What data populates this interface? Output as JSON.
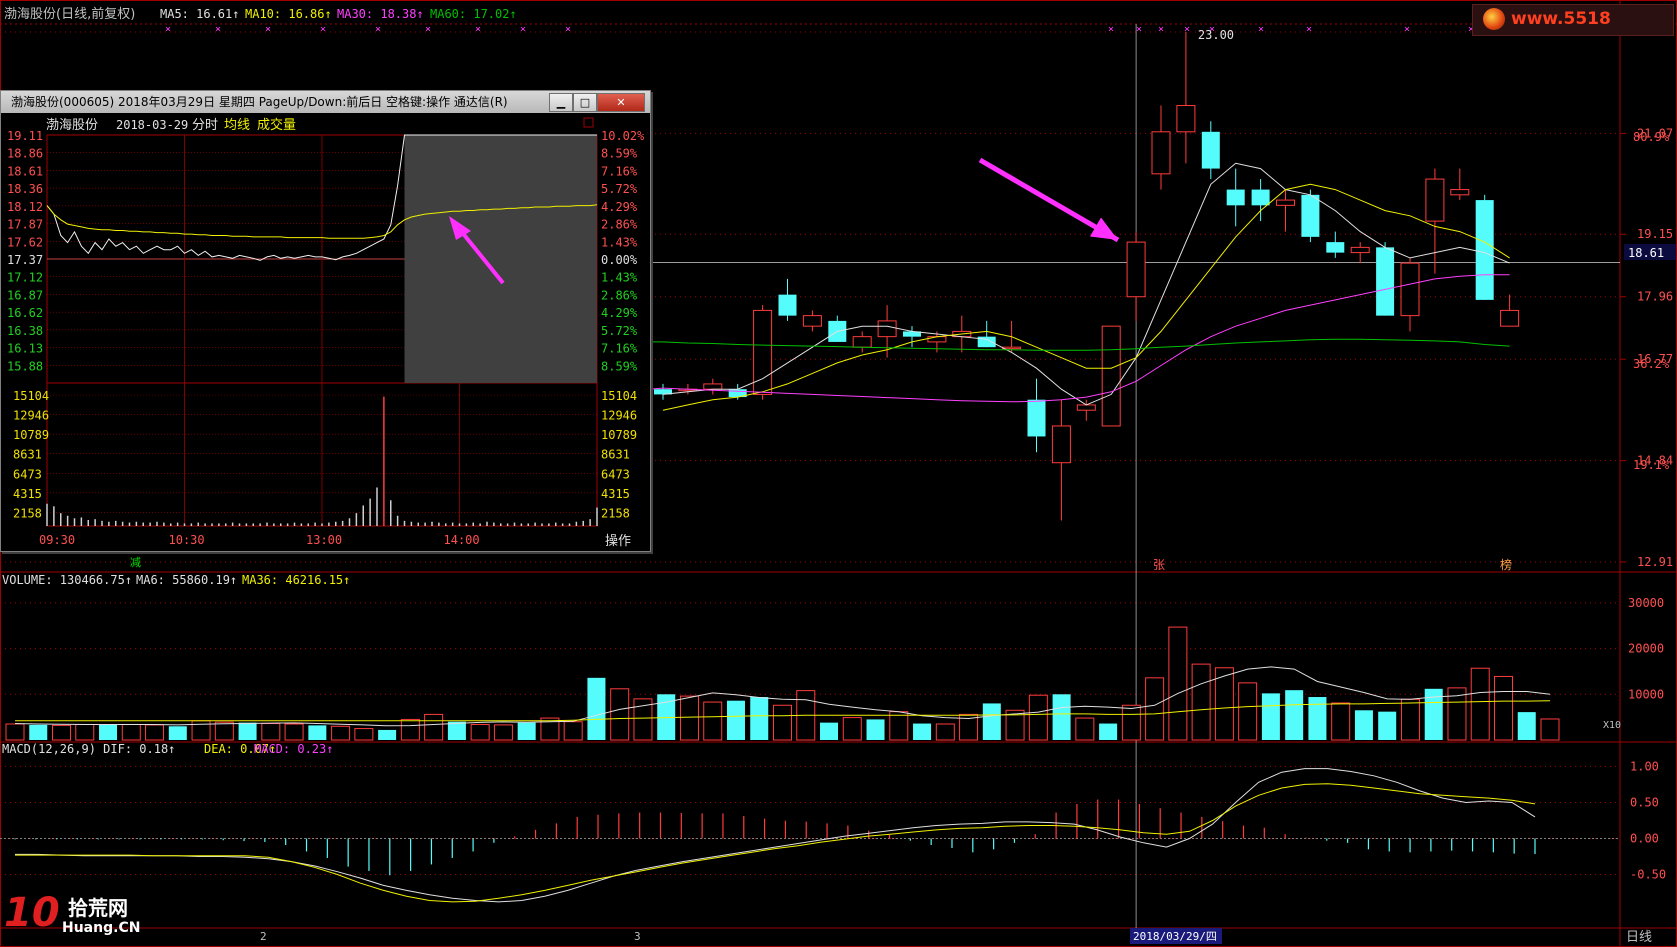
{
  "colors": {
    "up": "#ff3c3c",
    "down": "#54fcfc",
    "white": "#e0e0e0",
    "yellow": "#f0f000",
    "magenta": "#ff40ff",
    "green": "#00c000",
    "grid_red": "#a00000",
    "label_red": "#ff5050"
  },
  "main": {
    "title": "渤海股份(日线,前复权)",
    "indicators": [
      {
        "label": "MA5:",
        "value": "16.61",
        "color": "#e0e0e0"
      },
      {
        "label": "MA10:",
        "value": "16.86",
        "color": "#f0f000"
      },
      {
        "label": "MA30:",
        "value": "18.38",
        "color": "#ff40ff"
      },
      {
        "label": "MA60:",
        "value": "17.02",
        "color": "#00c000"
      }
    ],
    "price_axis": [
      "23.00",
      "21.07",
      "19.15",
      "17.96",
      "16.77",
      "14.84",
      "12.91"
    ],
    "pct_axis": [
      "80.9%",
      "36.2%",
      "19.1%"
    ],
    "current_price": "18.61",
    "high_label": "23.00",
    "markers": {
      "zhang": "张",
      "bang": "榜",
      "jian": "减"
    },
    "period_label": "日线",
    "date_labels": [
      "2",
      "3"
    ],
    "crosshair_date": "2018/03/29/四"
  },
  "volume": {
    "header": [
      {
        "text": "VOLUME: 130466.75",
        "color": "#e0e0e0"
      },
      {
        "text": "MA6: 55860.19",
        "color": "#e0e0e0"
      },
      {
        "text": "MA36: 46216.15",
        "color": "#f0f000"
      }
    ],
    "axis": [
      "30000",
      "20000",
      "10000"
    ],
    "unit": "X10"
  },
  "macd": {
    "header": [
      {
        "text": "MACD(12,26,9) DIF: 0.18",
        "color": "#e0e0e0"
      },
      {
        "text": "DEA: 0.07",
        "color": "#f0f000"
      },
      {
        "text": "MACD: 0.23",
        "color": "#ff40ff"
      }
    ],
    "axis": [
      "1.00",
      "0.50",
      "0.00",
      "-0.50"
    ]
  },
  "popup": {
    "title": "渤海股份(000605) 2018年03月29日 星期四 PageUp/Down:前后日 空格键:操作 通达信(R)",
    "stock_name": "渤海股份",
    "date": "2018-03-29",
    "mode": "分时",
    "avg_label": "均线",
    "vol_label": "成交量",
    "price_ticks": [
      "19.11",
      "18.86",
      "18.61",
      "18.36",
      "18.12",
      "17.87",
      "17.62",
      "17.37",
      "17.12",
      "16.87",
      "16.62",
      "16.38",
      "16.13",
      "15.88"
    ],
    "pct_ticks": [
      "10.02%",
      "8.59%",
      "7.16%",
      "5.72%",
      "4.29%",
      "2.86%",
      "1.43%",
      "0.00%",
      "1.43%",
      "2.86%",
      "4.29%",
      "5.72%",
      "7.16%",
      "8.59%"
    ],
    "vol_ticks": [
      "15104",
      "12946",
      "10789",
      "8631",
      "6473",
      "4315",
      "2158"
    ],
    "time_ticks": [
      "09:30",
      "10:30",
      "13:00",
      "14:00"
    ],
    "action_label": "操作"
  },
  "watermarks": {
    "site_top": "www.5518",
    "logo_cn": "拾荒网",
    "logo_en": "Huang.CN",
    "logo_num": "10"
  },
  "chart_data": [
    {
      "type": "candlestick",
      "title": "渤海股份(日线,前复权)",
      "ylim": [
        12.91,
        23.0
      ],
      "series_ohlc": [
        {
          "o": 16.2,
          "h": 16.3,
          "l": 16.0,
          "c": 16.1
        },
        {
          "o": 16.2,
          "h": 16.3,
          "l": 16.1,
          "c": 16.2
        },
        {
          "o": 16.2,
          "h": 16.4,
          "l": 16.1,
          "c": 16.3
        },
        {
          "o": 16.2,
          "h": 16.3,
          "l": 16.0,
          "c": 16.05
        },
        {
          "o": 16.1,
          "h": 17.8,
          "l": 16.0,
          "c": 17.7
        },
        {
          "o": 18.0,
          "h": 18.3,
          "l": 17.5,
          "c": 17.6
        },
        {
          "o": 17.4,
          "h": 17.7,
          "l": 17.3,
          "c": 17.6
        },
        {
          "o": 17.5,
          "h": 17.6,
          "l": 17.1,
          "c": 17.1
        },
        {
          "o": 17.0,
          "h": 17.3,
          "l": 16.9,
          "c": 17.2
        },
        {
          "o": 17.2,
          "h": 17.8,
          "l": 16.8,
          "c": 17.5
        },
        {
          "o": 17.3,
          "h": 17.4,
          "l": 17.0,
          "c": 17.2
        },
        {
          "o": 17.1,
          "h": 17.3,
          "l": 16.9,
          "c": 17.2
        },
        {
          "o": 17.2,
          "h": 17.6,
          "l": 16.9,
          "c": 17.3
        },
        {
          "o": 17.2,
          "h": 17.5,
          "l": 17.0,
          "c": 17.0
        },
        {
          "o": 17.0,
          "h": 17.5,
          "l": 16.9,
          "c": 17.0
        },
        {
          "o": 16.0,
          "h": 16.4,
          "l": 15.0,
          "c": 15.3
        },
        {
          "o": 14.8,
          "h": 16.0,
          "l": 13.7,
          "c": 15.5
        },
        {
          "o": 15.8,
          "h": 16.0,
          "l": 15.6,
          "c": 15.9
        },
        {
          "o": 15.5,
          "h": 17.4,
          "l": 15.5,
          "c": 17.4
        },
        {
          "o": 17.96,
          "h": 19.2,
          "l": 17.5,
          "c": 19.0
        },
        {
          "o": 20.3,
          "h": 21.6,
          "l": 20.0,
          "c": 21.1
        },
        {
          "o": 21.1,
          "h": 23.0,
          "l": 20.5,
          "c": 21.6
        },
        {
          "o": 21.1,
          "h": 21.3,
          "l": 20.2,
          "c": 20.4
        },
        {
          "o": 20.0,
          "h": 20.4,
          "l": 19.3,
          "c": 19.7
        },
        {
          "o": 20.0,
          "h": 20.2,
          "l": 19.4,
          "c": 19.7
        },
        {
          "o": 19.7,
          "h": 20.0,
          "l": 19.2,
          "c": 19.8
        },
        {
          "o": 19.9,
          "h": 20.0,
          "l": 19.0,
          "c": 19.1
        },
        {
          "o": 19.0,
          "h": 19.2,
          "l": 18.7,
          "c": 18.8
        },
        {
          "o": 18.8,
          "h": 19.0,
          "l": 18.6,
          "c": 18.9
        },
        {
          "o": 18.9,
          "h": 19.0,
          "l": 17.6,
          "c": 17.6
        },
        {
          "o": 17.6,
          "h": 18.7,
          "l": 17.3,
          "c": 18.6
        },
        {
          "o": 19.4,
          "h": 20.4,
          "l": 18.4,
          "c": 20.2
        },
        {
          "o": 19.9,
          "h": 20.4,
          "l": 19.8,
          "c": 20.0
        },
        {
          "o": 19.8,
          "h": 19.9,
          "l": 17.9,
          "c": 17.9
        },
        {
          "o": 17.4,
          "h": 18.0,
          "l": 17.4,
          "c": 17.7
        }
      ],
      "ma5": [
        16.1,
        16.15,
        16.2,
        16.2,
        16.4,
        16.7,
        17.0,
        17.3,
        17.4,
        17.4,
        17.3,
        17.25,
        17.2,
        17.15,
        16.9,
        16.6,
        16.2,
        15.9,
        16.1,
        16.8,
        17.9,
        19.0,
        20.1,
        20.5,
        20.4,
        20.0,
        19.9,
        19.6,
        19.2,
        18.9,
        18.7,
        18.8,
        18.9,
        18.8,
        18.6
      ],
      "ma10": [
        15.8,
        15.9,
        16.0,
        16.05,
        16.15,
        16.3,
        16.5,
        16.7,
        16.85,
        16.95,
        17.1,
        17.2,
        17.25,
        17.3,
        17.2,
        17.0,
        16.8,
        16.6,
        16.6,
        16.8,
        17.3,
        17.9,
        18.5,
        19.1,
        19.6,
        20.0,
        20.1,
        20.0,
        19.8,
        19.6,
        19.5,
        19.3,
        19.2,
        19.0,
        18.7
      ],
      "ma30": [
        16.22,
        16.2,
        16.18,
        16.16,
        16.14,
        16.12,
        16.1,
        16.08,
        16.06,
        16.04,
        16.02,
        16.0,
        15.98,
        15.97,
        15.96,
        15.97,
        16.0,
        16.05,
        16.15,
        16.35,
        16.65,
        16.95,
        17.2,
        17.4,
        17.55,
        17.7,
        17.8,
        17.9,
        18.0,
        18.1,
        18.2,
        18.3,
        18.35,
        18.38,
        18.38
      ],
      "ma60": [
        17.1,
        17.08,
        17.07,
        17.05,
        17.04,
        17.03,
        17.02,
        17.01,
        17.0,
        16.99,
        16.98,
        16.97,
        16.96,
        16.95,
        16.95,
        16.94,
        16.94,
        16.94,
        16.95,
        16.97,
        17.0,
        17.02,
        17.05,
        17.08,
        17.1,
        17.12,
        17.14,
        17.15,
        17.15,
        17.14,
        17.13,
        17.12,
        17.1,
        17.05,
        17.02
      ]
    },
    {
      "type": "bar",
      "title": "VOLUME",
      "ylim": [
        0,
        35000
      ],
      "values": [
        3500,
        3300,
        3200,
        3400,
        3300,
        3400,
        3300,
        3000,
        4200,
        3900,
        3800,
        3600,
        3500,
        3200,
        3000,
        2500,
        2200,
        4500,
        5600,
        4000,
        3400,
        3300,
        3800,
        4800,
        4000,
        13600,
        11200,
        9000,
        10000,
        9600,
        8300,
        8600,
        9400,
        7600,
        10800,
        3800,
        4900,
        4500,
        6200,
        3600,
        3500,
        5600,
        8000,
        6500,
        9800,
        10000,
        4800,
        3600,
        7600,
        13600,
        24700,
        16600,
        15800,
        12500,
        10200,
        10900,
        9400,
        8100,
        6500,
        6200,
        8900,
        11200,
        11400,
        15700,
        13900,
        6100,
        4600
      ],
      "ma6": [
        3600,
        3500,
        3450,
        3400,
        3380,
        3400,
        3380,
        3300,
        3450,
        3550,
        3600,
        3700,
        3750,
        3620,
        3460,
        3300,
        3100,
        3150,
        3380,
        3640,
        3860,
        3960,
        3900,
        4000,
        4100,
        5400,
        6700,
        7500,
        8300,
        9300,
        10300,
        9900,
        9300,
        8900,
        8800,
        7800,
        7200,
        6600,
        6200,
        5300,
        4900,
        4700,
        5300,
        5700,
        6100,
        7100,
        7400,
        7200,
        6900,
        7600,
        10200,
        12300,
        14000,
        15500,
        16000,
        15500,
        12800,
        11600,
        10400,
        9000,
        8900,
        9400,
        9700,
        10400,
        10600,
        10600,
        10000
      ],
      "ma36": [
        4200,
        4200,
        4200,
        4200,
        4200,
        4200,
        4200,
        4200,
        4200,
        4200,
        4200,
        4200,
        4200,
        4200,
        4200,
        4200,
        4200,
        4200,
        4200,
        4200,
        4200,
        4200,
        4200,
        4200,
        4300,
        4500,
        4700,
        4800,
        4900,
        5000,
        5100,
        5200,
        5300,
        5300,
        5400,
        5400,
        5400,
        5400,
        5400,
        5400,
        5400,
        5400,
        5500,
        5500,
        5600,
        5700,
        5700,
        5600,
        5600,
        5700,
        6200,
        6600,
        7000,
        7300,
        7500,
        7700,
        7800,
        7900,
        7900,
        8000,
        8100,
        8200,
        8300,
        8400,
        8500,
        8500,
        8600
      ]
    },
    {
      "type": "bar",
      "title": "MACD(12,26,9)",
      "ylim": [
        -1.2,
        1.2
      ],
      "macd": [
        -0.02,
        -0.02,
        -0.02,
        -0.02,
        -0.02,
        -0.02,
        -0.02,
        -0.02,
        -0.02,
        -0.02,
        -0.04,
        -0.06,
        -0.08,
        -0.15,
        -0.3,
        -0.45,
        -0.65,
        -0.75,
        -0.85,
        -0.75,
        -0.6,
        -0.45,
        -0.3,
        -0.1,
        0.05,
        0.2,
        0.35,
        0.5,
        0.55,
        0.58,
        0.6,
        0.6,
        0.59,
        0.58,
        0.58,
        0.52,
        0.46,
        0.41,
        0.39,
        0.35,
        0.3,
        0.18,
        0.08,
        -0.05,
        -0.15,
        -0.22,
        -0.32,
        -0.25,
        -0.1,
        0.1,
        0.6,
        0.8,
        0.9,
        0.9,
        0.8,
        0.7,
        0.6,
        0.5,
        0.4,
        0.3,
        0.25,
        0.1,
        0.02,
        -0.05,
        -0.1,
        -0.25,
        -0.3,
        -0.32,
        -0.3,
        -0.28,
        -0.3,
        -0.32,
        -0.35,
        -0.36
      ],
      "dif": [
        -0.22,
        -0.22,
        -0.23,
        -0.24,
        -0.24,
        -0.24,
        -0.24,
        -0.24,
        -0.25,
        -0.25,
        -0.26,
        -0.28,
        -0.32,
        -0.38,
        -0.46,
        -0.55,
        -0.65,
        -0.72,
        -0.78,
        -0.83,
        -0.86,
        -0.88,
        -0.86,
        -0.8,
        -0.72,
        -0.62,
        -0.52,
        -0.44,
        -0.38,
        -0.32,
        -0.27,
        -0.22,
        -0.17,
        -0.12,
        -0.07,
        -0.02,
        0.03,
        0.07,
        0.11,
        0.15,
        0.18,
        0.2,
        0.21,
        0.23,
        0.23,
        0.22,
        0.2,
        0.12,
        0.02,
        -0.06,
        -0.12,
        0.0,
        0.2,
        0.5,
        0.78,
        0.92,
        0.97,
        0.97,
        0.93,
        0.87,
        0.78,
        0.66,
        0.56,
        0.5,
        0.52,
        0.5,
        0.3
      ],
      "dea": [
        -0.23,
        -0.23,
        -0.23,
        -0.23,
        -0.23,
        -0.23,
        -0.24,
        -0.24,
        -0.24,
        -0.24,
        -0.24,
        -0.26,
        -0.32,
        -0.4,
        -0.5,
        -0.62,
        -0.72,
        -0.8,
        -0.86,
        -0.88,
        -0.87,
        -0.83,
        -0.78,
        -0.72,
        -0.65,
        -0.58,
        -0.52,
        -0.46,
        -0.4,
        -0.34,
        -0.29,
        -0.24,
        -0.19,
        -0.14,
        -0.1,
        -0.05,
        -0.01,
        0.03,
        0.06,
        0.09,
        0.12,
        0.14,
        0.15,
        0.17,
        0.18,
        0.18,
        0.17,
        0.15,
        0.12,
        0.08,
        0.06,
        0.1,
        0.25,
        0.45,
        0.6,
        0.7,
        0.75,
        0.76,
        0.74,
        0.7,
        0.66,
        0.62,
        0.6,
        0.58,
        0.56,
        0.53,
        0.48
      ]
    },
    {
      "type": "line",
      "title": "渤海股份 2018-03-29 分时",
      "ylim": [
        15.63,
        19.11
      ],
      "price": [
        18.12,
        18.0,
        17.7,
        17.6,
        17.75,
        17.55,
        17.45,
        17.6,
        17.5,
        17.65,
        17.55,
        17.6,
        17.5,
        17.55,
        17.45,
        17.5,
        17.55,
        17.5,
        17.5,
        17.55,
        17.45,
        17.5,
        17.42,
        17.48,
        17.4,
        17.42,
        17.4,
        17.38,
        17.42,
        17.4,
        17.38,
        17.35,
        17.4,
        17.42,
        17.38,
        17.4,
        17.38,
        17.4,
        17.42,
        17.4,
        17.4,
        17.38,
        17.36,
        17.4,
        17.42,
        17.45,
        17.5,
        17.55,
        17.6,
        17.65,
        17.85,
        18.4,
        19.11,
        19.11,
        19.11,
        19.11,
        19.11,
        19.11,
        19.11,
        19.11,
        19.11,
        19.11,
        19.11,
        19.11,
        19.11,
        19.11,
        19.11,
        19.11,
        19.11,
        19.11,
        19.11,
        19.11,
        19.11,
        19.11,
        19.11,
        19.11,
        19.11,
        19.11,
        19.11,
        19.11,
        19.11
      ],
      "avg": [
        18.12,
        18.0,
        17.92,
        17.86,
        17.84,
        17.82,
        17.8,
        17.79,
        17.78,
        17.78,
        17.77,
        17.77,
        17.76,
        17.76,
        17.75,
        17.75,
        17.74,
        17.74,
        17.73,
        17.73,
        17.72,
        17.72,
        17.71,
        17.71,
        17.7,
        17.7,
        17.7,
        17.69,
        17.69,
        17.69,
        17.68,
        17.68,
        17.68,
        17.68,
        17.68,
        17.67,
        17.67,
        17.67,
        17.67,
        17.67,
        17.67,
        17.66,
        17.66,
        17.66,
        17.66,
        17.66,
        17.66,
        17.67,
        17.68,
        17.7,
        17.75,
        17.85,
        17.92,
        17.96,
        17.98,
        18.0,
        18.01,
        18.02,
        18.03,
        18.04,
        18.04,
        18.05,
        18.05,
        18.06,
        18.06,
        18.07,
        18.07,
        18.08,
        18.08,
        18.09,
        18.09,
        18.1,
        18.1,
        18.1,
        18.11,
        18.11,
        18.11,
        18.12,
        18.12,
        18.12,
        18.13
      ],
      "volume": [
        2600,
        2300,
        1500,
        1200,
        900,
        1000,
        700,
        800,
        600,
        500,
        600,
        500,
        400,
        500,
        400,
        400,
        500,
        400,
        300,
        400,
        300,
        300,
        400,
        300,
        300,
        300,
        300,
        400,
        300,
        300,
        300,
        300,
        400,
        300,
        300,
        300,
        400,
        300,
        300,
        400,
        300,
        400,
        500,
        600,
        900,
        1500,
        2400,
        3200,
        4500,
        15104,
        3000,
        1200,
        600,
        500,
        400,
        400,
        500,
        400,
        300,
        400,
        300,
        300,
        400,
        300,
        500,
        400,
        300,
        300,
        400,
        300,
        300,
        400,
        300,
        300,
        400,
        300,
        300,
        500,
        600,
        800,
        2158
      ]
    }
  ]
}
